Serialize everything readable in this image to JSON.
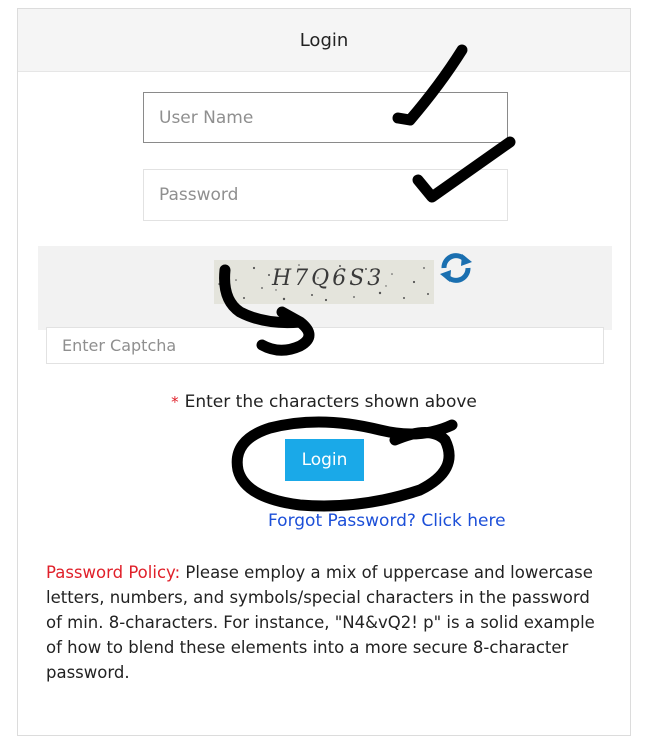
{
  "header": {
    "title": "Login"
  },
  "form": {
    "username_placeholder": "User Name",
    "password_placeholder": "Password",
    "captcha_text": "H7Q6S3",
    "captcha_placeholder": "Enter Captcha",
    "captcha_hint_star": "*",
    "captcha_hint": "Enter the characters shown above",
    "login_button": "Login",
    "forgot_link": "Forgot Password? Click here"
  },
  "policy": {
    "label": "Password Policy:",
    "text": " Please employ a mix of uppercase and lowercase letters, numbers, and symbols/special characters in the password of min. 8-characters. For instance, \"N4&vQ2! p\" is a solid example of how to blend these elements into a more secure 8-character password."
  },
  "colors": {
    "accent": "#1aa9e8",
    "required": "#e0202a",
    "link": "#1c4fd8",
    "refresh_icon": "#1a6fb0"
  },
  "icons": {
    "refresh": "refresh-icon"
  }
}
